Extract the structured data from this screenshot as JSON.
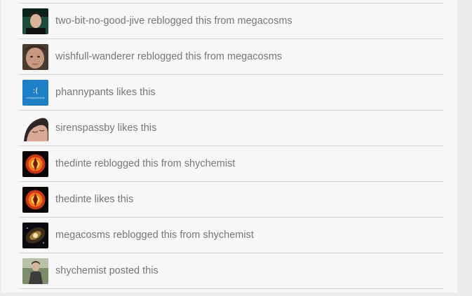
{
  "notes": [
    {
      "avatar_icon": "avatar-man-dark-icon",
      "username": "two-bit-no-good-jive",
      "action": "reblogged this from",
      "source": "megacosms"
    },
    {
      "avatar_icon": "avatar-man-face-icon",
      "username": "wishfull-wanderer",
      "action": "reblogged this from",
      "source": "megacosms"
    },
    {
      "avatar_icon": "avatar-blue-emoticon-icon",
      "avatar_text": ":(",
      "avatar_subtext": "unhappyalmosts",
      "username": "phannypants",
      "action": "likes this",
      "source": ""
    },
    {
      "avatar_icon": "avatar-sleeping-face-icon",
      "username": "sirenspassby",
      "action": "likes this",
      "source": ""
    },
    {
      "avatar_icon": "avatar-phoenix-icon",
      "username": "thedinte",
      "action": "reblogged this from",
      "source": "shychemist"
    },
    {
      "avatar_icon": "avatar-phoenix-icon",
      "username": "thedinte",
      "action": "likes this",
      "source": ""
    },
    {
      "avatar_icon": "avatar-galaxy-icon",
      "username": "megacosms",
      "action": "reblogged this from",
      "source": "shychemist"
    },
    {
      "avatar_icon": "avatar-man-outdoor-icon",
      "username": "shychemist",
      "action": "posted this",
      "source": ""
    }
  ],
  "colors": {
    "panel": "#f7f7f7",
    "text": "#777777",
    "divider": "#d6d6d6",
    "background": "#ebebeb"
  }
}
